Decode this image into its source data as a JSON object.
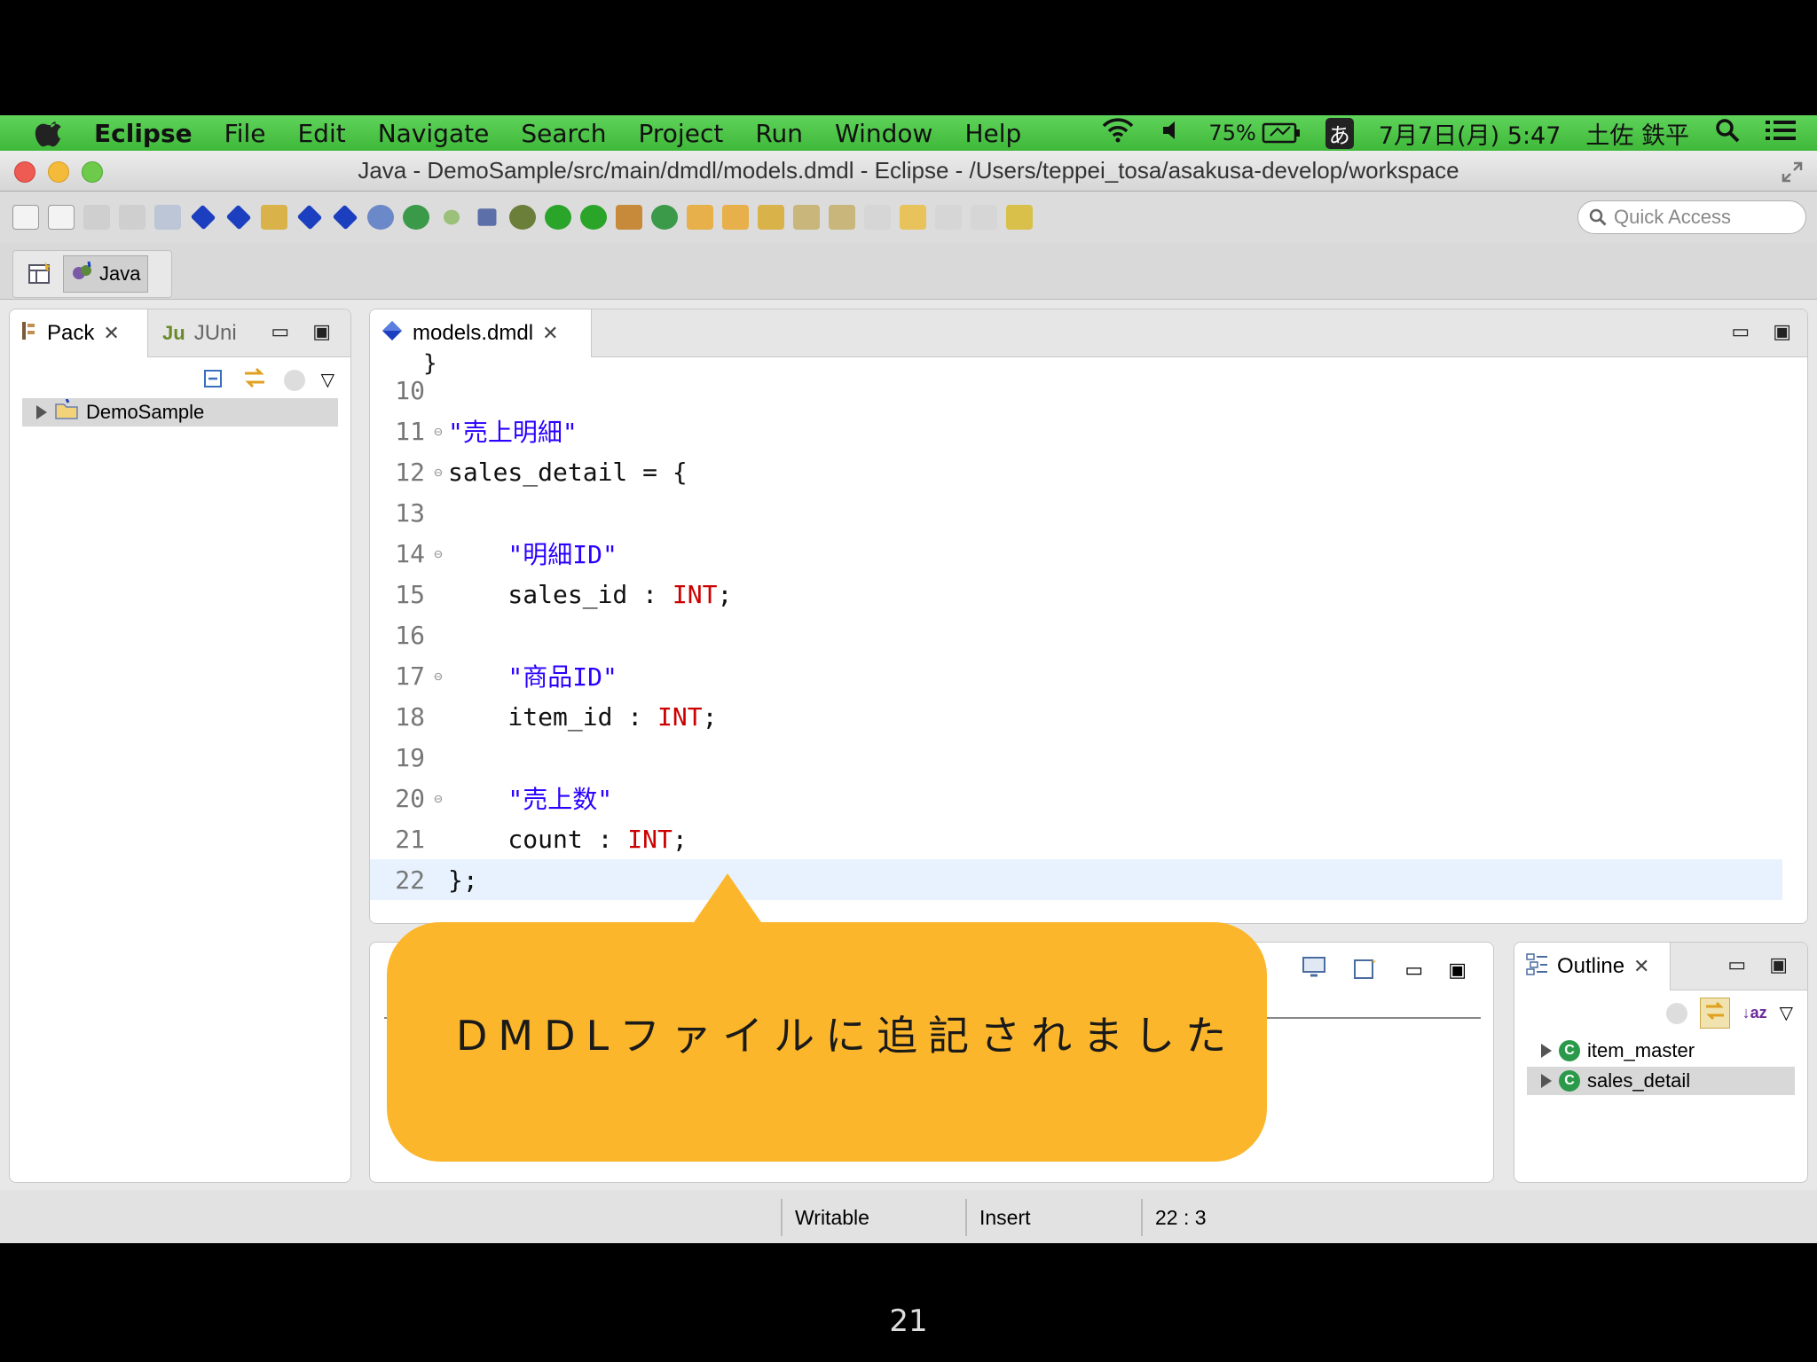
{
  "menubar": {
    "app": "Eclipse",
    "items": [
      "File",
      "Edit",
      "Navigate",
      "Search",
      "Project",
      "Run",
      "Window",
      "Help"
    ],
    "battery": "75%",
    "input_method": "あ",
    "datetime": "7月7日(月)  5:47",
    "user": "土佐 鉄平"
  },
  "window": {
    "title": "Java - DemoSample/src/main/dmdl/models.dmdl - Eclipse - /Users/teppei_tosa/asakusa-develop/workspace",
    "quick_access_placeholder": "Quick Access",
    "perspective_label": "Java"
  },
  "left_panel": {
    "tab_package": "Pack",
    "tab_junit": "JUni",
    "tree_root": "DemoSample"
  },
  "editor": {
    "tab_label": "models.dmdl",
    "lines": [
      {
        "n": "10",
        "fold": "",
        "text": ""
      },
      {
        "n": "11",
        "fold": "⊖",
        "text": "\"売上明細\"",
        "type": "str"
      },
      {
        "n": "12",
        "fold": "⊖",
        "text": "sales_detail = {",
        "type": "plain"
      },
      {
        "n": "13",
        "fold": "",
        "text": ""
      },
      {
        "n": "14",
        "fold": "⊖",
        "text": "    \"明細ID\"",
        "type": "str"
      },
      {
        "n": "15",
        "fold": "",
        "text": "    sales_id : ",
        "kw": "INT",
        "tail": ";"
      },
      {
        "n": "16",
        "fold": "",
        "text": ""
      },
      {
        "n": "17",
        "fold": "⊖",
        "text": "    \"商品ID\"",
        "type": "str"
      },
      {
        "n": "18",
        "fold": "",
        "text": "    item_id : ",
        "kw": "INT",
        "tail": ";"
      },
      {
        "n": "19",
        "fold": "",
        "text": ""
      },
      {
        "n": "20",
        "fold": "⊖",
        "text": "    \"売上数\"",
        "type": "str"
      },
      {
        "n": "21",
        "fold": "",
        "text": "    count : ",
        "kw": "INT",
        "tail": ";"
      },
      {
        "n": "22",
        "fold": "",
        "text": "};",
        "type": "plain",
        "current": true
      }
    ]
  },
  "outline": {
    "tab_label": "Outline",
    "items": [
      "item_master",
      "sales_detail"
    ]
  },
  "status": {
    "writable": "Writable",
    "insert": "Insert",
    "position": "22 : 3"
  },
  "callout": {
    "text": "DMDLファイルに追記されました"
  },
  "slide_number": "21",
  "colors": {
    "menubar": "#4cc548",
    "callout": "#fbb62b",
    "keyword": "#cc0000",
    "string": "#2a00ff"
  }
}
